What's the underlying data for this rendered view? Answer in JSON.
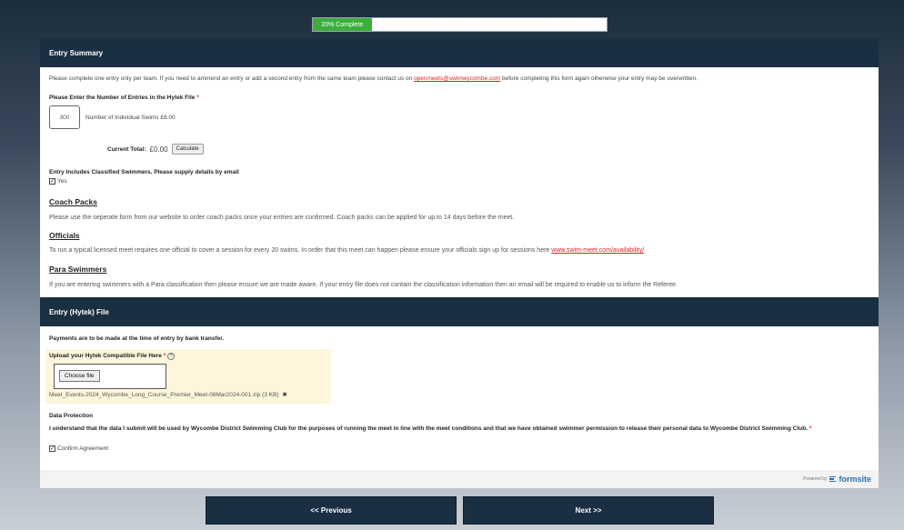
{
  "progress": {
    "percent": 20,
    "label": "20% Complete"
  },
  "entry_summary": {
    "title": "Entry Summary",
    "intro_pre": "Please complete one entry only per team. If you need to ammend an entry or add a second entry from the same team please contact us on ",
    "intro_email": "openmeets@swimwycombe.com",
    "intro_post": " before completing this form again otherwise your entry may be overwritten.",
    "entries_label": "Please Enter the Number of Entries in the Hytek File",
    "required_mark": "*",
    "entries_value": "300",
    "entries_desc": "Number of Individual Swims £8.00",
    "total_label": "Current Total:",
    "total_value": "£0.00",
    "calculate_label": "Calculate",
    "classified_label": "Entry Includes Classified Swimmers. Please supply details by email",
    "classified_option": "Yes",
    "coach_heading": "Coach Packs",
    "coach_text": "Please use the seperate form from our website to order coach packs once your entries are confirmed.  Coach packs can be applied for up to 14 days before the meet.",
    "officials_heading": "Officials",
    "officials_text": "To run a typical licensed meet requires one official to cover a session for every 20 swims. In order that this meet can happen please ensure your officials sign up for sessions here ",
    "officials_link": "www.swim-meet.com/availability/",
    "para_heading": "Para Swimmers",
    "para_text": "If you are entering swimmers with a Para classification then please ensure we are made aware. If your entry file does not contain the classification information then an email will be required to enable us to inform the Referee."
  },
  "entry_file": {
    "title": "Entry (Hytek) File",
    "payment_text": "Payments are to be made at the time of entry by bank transfer.",
    "upload_label": "Upload your Hytek Compatible File Here",
    "help_icon": "?",
    "choose_label": "Choose file",
    "file_name": "Meet_Events-2024_Wycombe_Long_Course_Premier_Meet-08Mar2024-001.zip (3 KB)",
    "remove_icon": "✖",
    "dp_heading": "Data Protection",
    "dp_text": "I understand that the data I submit will be used by Wycombe District Swimming Club for the purposes of running the meet in line with the meet conditions and that we have obtained swimmer permission to release their personal data to Wycombe District Swimming Club.",
    "confirm_label": "Confirm Agreement"
  },
  "powered_by": {
    "prefix": "Powered by",
    "brand": "formsite"
  },
  "nav": {
    "previous": "<< Previous",
    "next": "Next >>"
  },
  "colors": {
    "header": "#1a2f42",
    "progress": "#3cae3c",
    "link": "#dd2222",
    "upload_bg": "#fdf6dc"
  }
}
